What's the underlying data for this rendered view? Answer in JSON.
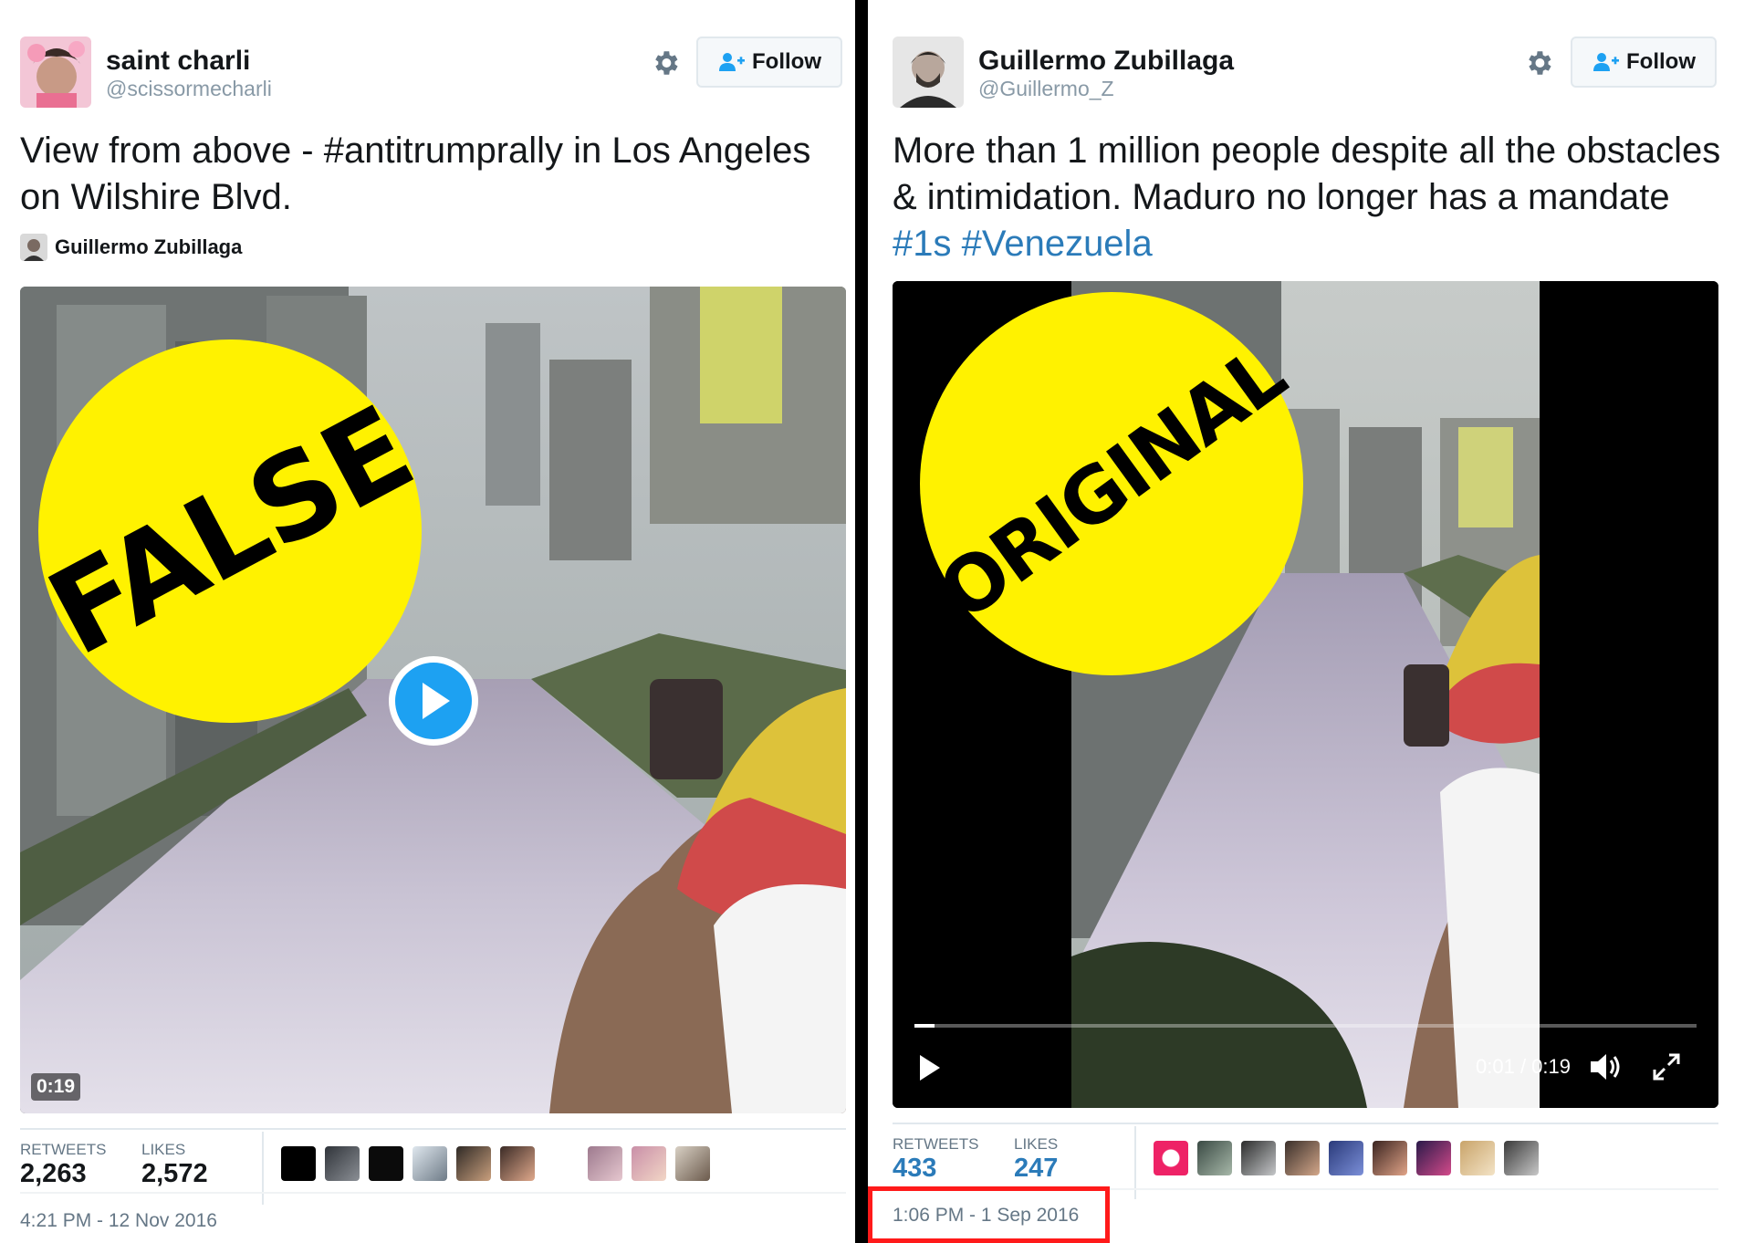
{
  "left_tweet": {
    "display_name": "saint charli",
    "handle": "@scissormecharli",
    "follow_label": "Follow",
    "text": "View from above - #antitrumprally in Los Angeles on Wilshire Blvd.",
    "via_name": "Guillermo Zubillaga",
    "stamp_text": "FALSE",
    "video_duration": "0:19",
    "retweets_label": "RETWEETS",
    "retweets_count": "2,263",
    "likes_label": "LIKES",
    "likes_count": "2,572",
    "timestamp": "4:21 PM - 12 Nov 2016"
  },
  "right_tweet": {
    "display_name": "Guillermo Zubillaga",
    "handle": "@Guillermo_Z",
    "follow_label": "Follow",
    "text_plain": "More than 1 million people despite all the obstacles & intimidation. Maduro no longer has a mandate",
    "hashtags": "#1s #Venezuela",
    "stamp_text": "ORIGINAL",
    "video_time": "0:01 / 0:19",
    "video_progress_fraction": 0.026,
    "retweets_label": "RETWEETS",
    "retweets_count": "433",
    "likes_label": "LIKES",
    "likes_count": "247",
    "timestamp": "1:06 PM - 1 Sep 2016"
  },
  "icons": {
    "settings": "gear-icon",
    "follow": "add-person-icon",
    "play": "play-icon",
    "volume": "volume-icon",
    "fullscreen": "fullscreen-icon"
  },
  "colors": {
    "stamp_yellow": "#fff200",
    "link_blue": "#2b7bb9",
    "highlight_red": "#ff1a1a"
  }
}
